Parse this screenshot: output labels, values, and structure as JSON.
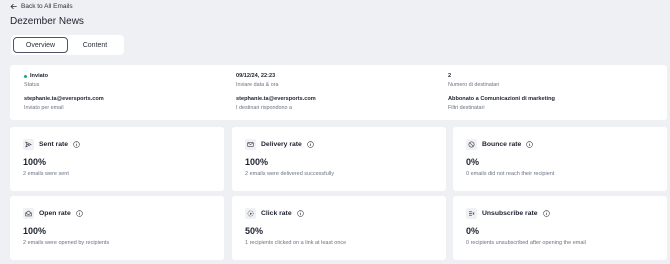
{
  "nav": {
    "back_label": "Back to All Emails"
  },
  "page": {
    "title": "Dezember News"
  },
  "tabs": [
    {
      "label": "Overview",
      "active": true
    },
    {
      "label": "Content",
      "active": false
    }
  ],
  "info": {
    "status": {
      "value": "Inviato",
      "label": "Status"
    },
    "sent_date": {
      "value": "09/12/24, 22:23",
      "label": "Inviare data & ora"
    },
    "recipients_count": {
      "value": "2",
      "label": "Numero di destinatari"
    },
    "sender": {
      "value": "stephanie.ta@eversports.com",
      "label": "Inviato per email"
    },
    "reply_to": {
      "value": "stephanie.ta@eversports.com",
      "label": "I destinari rispondono a"
    },
    "filter": {
      "value": "Abbonato a Comunicazioni di marketing",
      "label": "Filtri destinatari"
    }
  },
  "metrics": {
    "sent": {
      "title": "Sent rate",
      "value": "100%",
      "desc": "2 emails were sent"
    },
    "delivery": {
      "title": "Delivery rate",
      "value": "100%",
      "desc": "2 emails were delivered successfully"
    },
    "bounce": {
      "title": "Bounce rate",
      "value": "0%",
      "desc": "0 emails did not reach their recipient"
    },
    "open": {
      "title": "Open rate",
      "value": "100%",
      "desc": "2 emails were opened by recipients"
    },
    "click": {
      "title": "Click rate",
      "value": "50%",
      "desc": "1 recipients clicked on a link at least once"
    },
    "unsubscribe": {
      "title": "Unsubscribe rate",
      "value": "0%",
      "desc": "0 recipients unsubscribed after opening the email"
    }
  },
  "colors": {
    "status_dot": "#19a974",
    "background": "#eef0f3",
    "card": "#ffffff"
  }
}
